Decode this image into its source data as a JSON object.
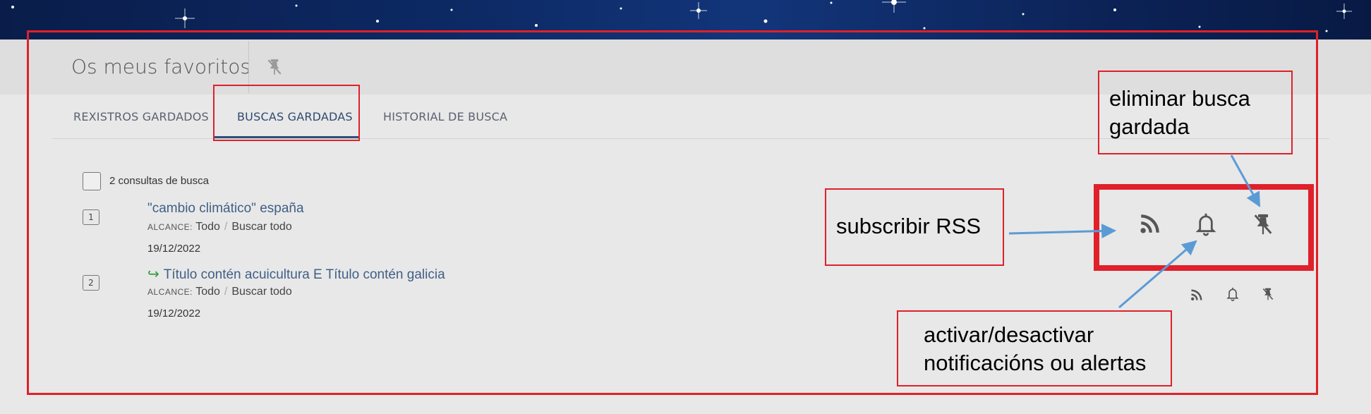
{
  "page": {
    "title": "Os meus favoritos"
  },
  "tabs": [
    {
      "label": "REXISTROS GARDADOS",
      "active": false
    },
    {
      "label": "BUSCAS GARDADAS",
      "active": true
    },
    {
      "label": "HISTORIAL DE BUSCA",
      "active": false
    }
  ],
  "list": {
    "count_label": "2 consultas de busca",
    "items": [
      {
        "index": "1",
        "query": "\"cambio climático\" españa",
        "scope_key": "ALCANCE:",
        "scope_value": "Todo",
        "scope_target": "Buscar todo",
        "date": "19/12/2022",
        "redo_icon": false
      },
      {
        "index": "2",
        "query": "Título contén acuicultura E Título contén galicia",
        "scope_key": "ALCANCE:",
        "scope_value": "Todo",
        "scope_target": "Buscar todo",
        "date": "19/12/2022",
        "redo_icon": true
      }
    ]
  },
  "icons": {
    "rss": "rss-icon",
    "bell": "bell-icon",
    "unpin": "unpin-icon",
    "redo": "redo-arrow-icon"
  },
  "annotations": {
    "rss": "subscribir RSS",
    "delete_line1": "eliminar busca",
    "delete_line2": "gardada",
    "alerts_line1": "activar/desactivar",
    "alerts_line2": "notificacións ou alertas"
  },
  "colors": {
    "accent": "#2f4f7a",
    "link": "#3f5f86",
    "annotation_red": "#e0202a",
    "arrow_blue": "#5b9bd5",
    "redo_green": "#2f9f3f"
  }
}
